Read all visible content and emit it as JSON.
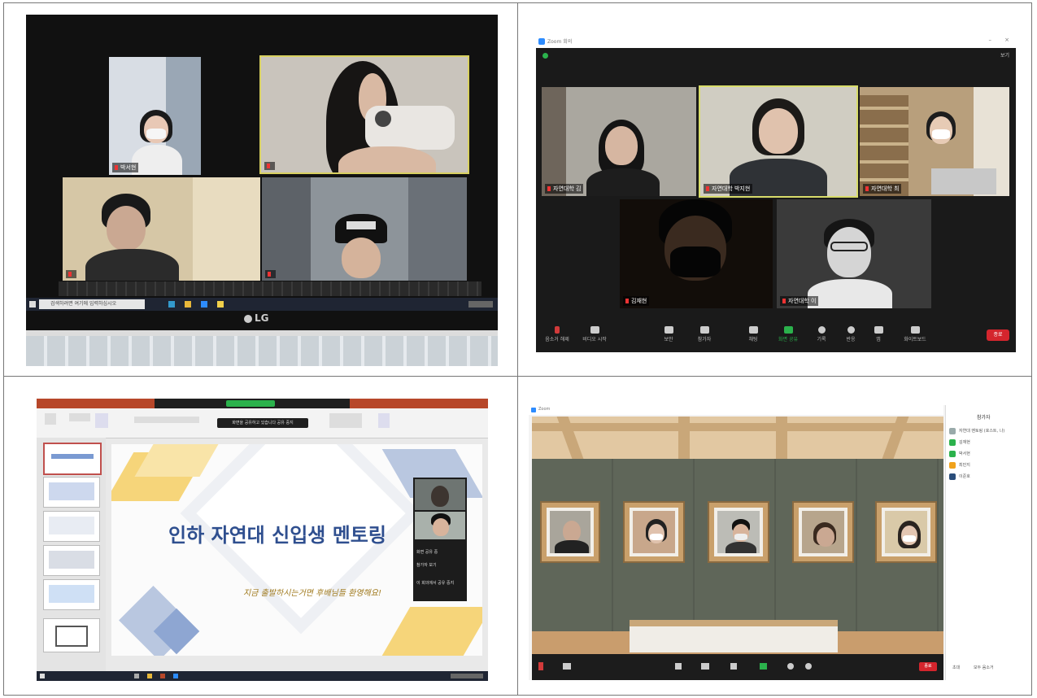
{
  "panels": {
    "top_left": {
      "laptop_brand": "LG",
      "participants": [
        "박서현",
        "",
        "",
        ""
      ],
      "taskbar_search": "검색하려면 여기에 입력하십시오"
    },
    "top_right": {
      "window_title": "Zoom 회의",
      "view_button": "보기",
      "participants": [
        "자연대학 김",
        "자연대학 박지현",
        "자연대학 최",
        "김재현",
        "자연대학 이"
      ],
      "toolbar": [
        "음소거 해제",
        "비디오 시작",
        "보안",
        "참가자",
        "채팅",
        "화면 공유",
        "기록",
        "반응",
        "앱",
        "화이트보드"
      ],
      "end_button": "종료",
      "accent_color": "#1e8a3e",
      "end_color": "#d4252d"
    },
    "bottom_left": {
      "slide_title": "인하 자연대 신입생 멘토링",
      "slide_subtitle": "지금 출발하시는거면 후배님들 환영해요!",
      "banner_text": "화면을 공유하고 있습니다 공유 중지",
      "side_items": [
        "화면 공유 중",
        "참가자 보기",
        "이 회의에서 공유 중지"
      ],
      "accent_color": "#b7472a"
    },
    "bottom_right": {
      "window_title": "Zoom",
      "panel_title": "참가자",
      "participants": [
        "자연대 멘토링 (호스트, 나)",
        "김재현",
        "박서현",
        "최민지",
        "이준호"
      ],
      "panel_buttons": [
        "초대",
        "모두 음소거"
      ],
      "end_button": "종료"
    }
  }
}
